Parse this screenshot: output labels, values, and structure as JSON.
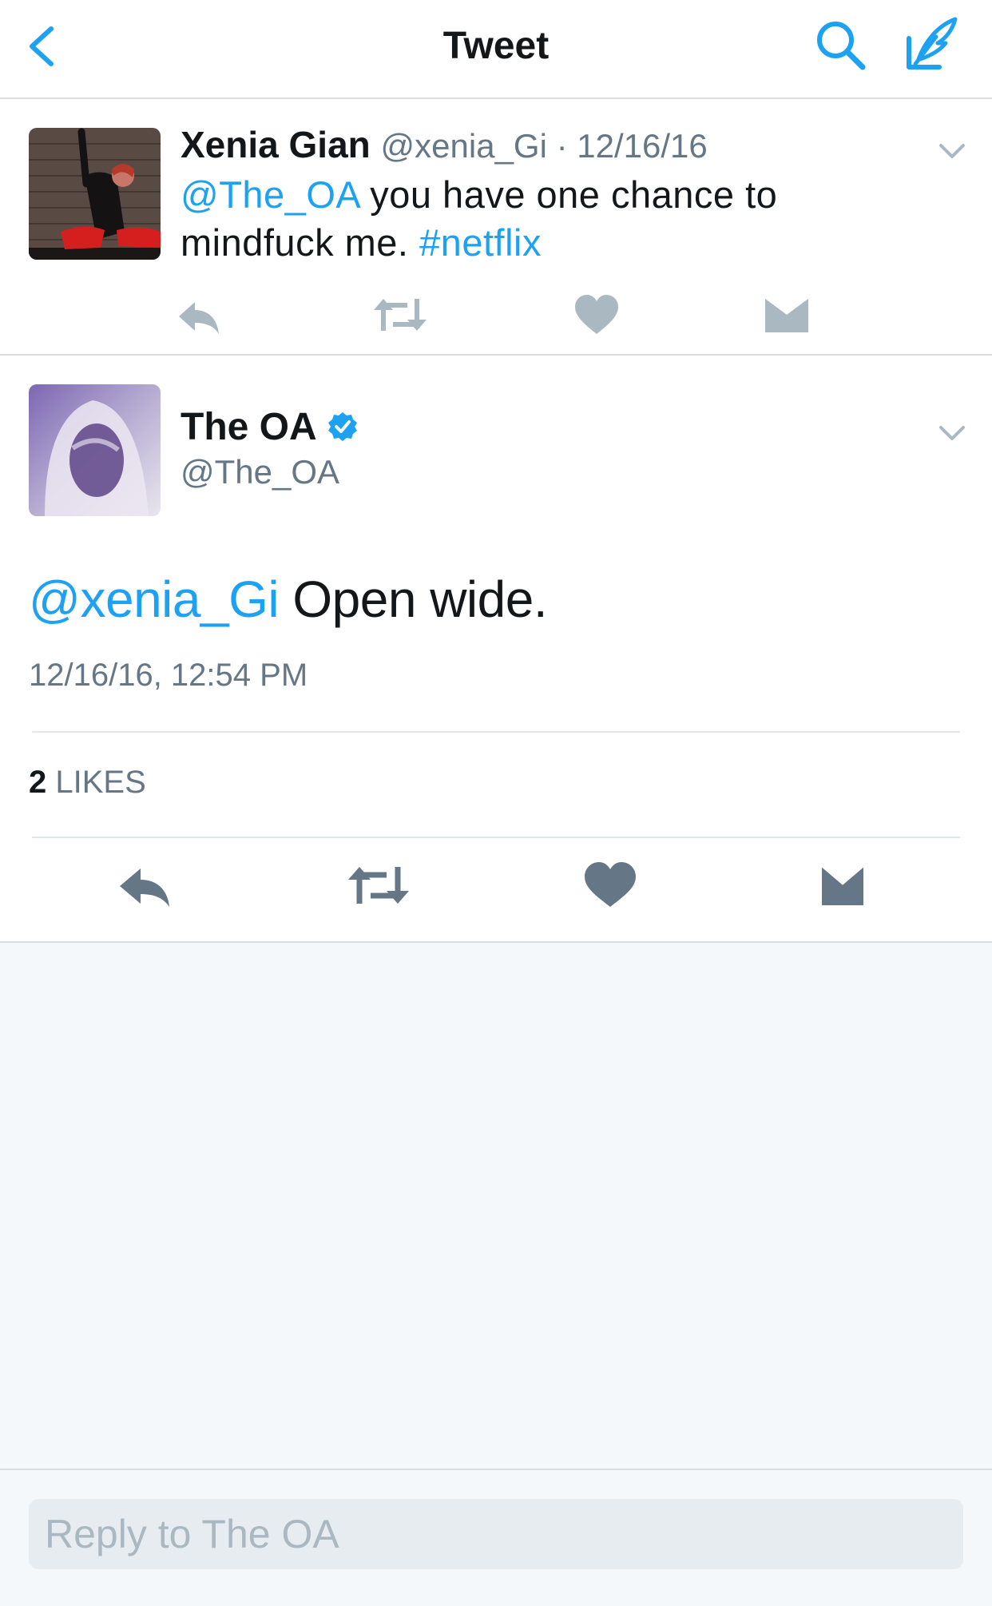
{
  "navbar": {
    "title": "Tweet",
    "back_icon": "chevron-left-icon",
    "search_icon": "search-icon",
    "compose_icon": "compose-icon",
    "accent_color": "#1da1f2"
  },
  "parent_tweet": {
    "name": "Xenia Gian",
    "handle": "@xenia_Gi",
    "separator": " · ",
    "date": "12/16/16",
    "text_mention": "@The_OA",
    "text_body_1": " you have one chance to",
    "text_body_2": "mindfuck me. ",
    "text_hashtag": "#netflix",
    "actions": [
      "reply-icon",
      "retweet-icon",
      "like-icon",
      "direct-message-icon"
    ]
  },
  "main_tweet": {
    "name": "The OA",
    "verified": true,
    "handle": "@The_OA",
    "text_mention": "@xenia_Gi",
    "text_body": " Open wide.",
    "timestamp": "12/16/16, 12:54 PM",
    "likes_count": "2",
    "likes_label": " LIKES",
    "actions": [
      "reply-icon",
      "retweet-icon",
      "like-icon",
      "direct-message-icon"
    ]
  },
  "reply": {
    "placeholder": "Reply to The OA"
  }
}
